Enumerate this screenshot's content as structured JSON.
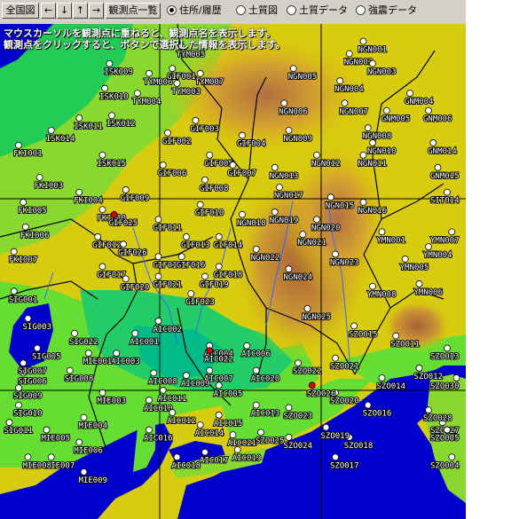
{
  "toolbar": {
    "overview_label": "全国図",
    "left_arrow": "←",
    "down_arrow": "↓",
    "up_arrow": "↑",
    "right_arrow": "→",
    "list_label": "観測点一覧",
    "radio_options": [
      {
        "label": "住所/履歴",
        "selected": true
      },
      {
        "label": "土質図",
        "selected": false
      },
      {
        "label": "土質データ",
        "selected": false
      },
      {
        "label": "強震データ",
        "selected": false
      }
    ]
  },
  "info": {
    "line1": "マウスカーソルを観測点に重ねると、観測点名を表示します。",
    "line2": "観測点をクリックすると、ボタンで選択した情報を表示します。"
  },
  "colors": {
    "sea": "#0000cc",
    "lowland": "#00cc66",
    "plain": "#66dd33",
    "hill": "#ddcc00",
    "mountain": "#cc8844",
    "station": "#ffffff",
    "selected_station": "#dd0000",
    "border": "#000000",
    "river": "#3366ff"
  },
  "stations": [
    {
      "id": "ISK009",
      "lon": 0.235,
      "lat": 0.08
    },
    {
      "id": "ISK010",
      "lon": 0.225,
      "lat": 0.13
    },
    {
      "id": "ISK011",
      "lon": 0.17,
      "lat": 0.19
    },
    {
      "id": "ISK012",
      "lon": 0.24,
      "lat": 0.185
    },
    {
      "id": "ISK014",
      "lon": 0.11,
      "lat": 0.215
    },
    {
      "id": "ISK015",
      "lon": 0.22,
      "lat": 0.265
    },
    {
      "id": "FKI001",
      "lon": 0.04,
      "lat": 0.245
    },
    {
      "id": "FKI003",
      "lon": 0.085,
      "lat": 0.31
    },
    {
      "id": "FKI004",
      "lon": 0.17,
      "lat": 0.34
    },
    {
      "id": "FKI005",
      "lon": 0.05,
      "lat": 0.36
    },
    {
      "id": "FKI006",
      "lon": 0.055,
      "lat": 0.41
    },
    {
      "id": "FKI007",
      "lon": 0.03,
      "lat": 0.46
    },
    {
      "id": "FKI010",
      "lon": 0.22,
      "lat": 0.375
    },
    {
      "id": "TYM005",
      "lon": 0.39,
      "lat": 0.045
    },
    {
      "id": "TYM006",
      "lon": 0.32,
      "lat": 0.1
    },
    {
      "id": "TYM007",
      "lon": 0.43,
      "lat": 0.1
    },
    {
      "id": "TYM003",
      "lon": 0.38,
      "lat": 0.12
    },
    {
      "id": "TYM004",
      "lon": 0.295,
      "lat": 0.14
    },
    {
      "id": "GIF001",
      "lon": 0.37,
      "lat": 0.09
    },
    {
      "id": "GIF002",
      "lon": 0.36,
      "lat": 0.22
    },
    {
      "id": "GIF003",
      "lon": 0.42,
      "lat": 0.195
    },
    {
      "id": "GIF004",
      "lon": 0.52,
      "lat": 0.225
    },
    {
      "id": "GIF005",
      "lon": 0.45,
      "lat": 0.265
    },
    {
      "id": "GIF006",
      "lon": 0.35,
      "lat": 0.285
    },
    {
      "id": "GIF007",
      "lon": 0.5,
      "lat": 0.285
    },
    {
      "id": "GIF008",
      "lon": 0.44,
      "lat": 0.315
    },
    {
      "id": "GIF009",
      "lon": 0.27,
      "lat": 0.335
    },
    {
      "id": "GIF010",
      "lon": 0.43,
      "lat": 0.365
    },
    {
      "id": "GIF011",
      "lon": 0.34,
      "lat": 0.395
    },
    {
      "id": "GIF012",
      "lon": 0.21,
      "lat": 0.43
    },
    {
      "id": "GIF013",
      "lon": 0.4,
      "lat": 0.43
    },
    {
      "id": "GIF014",
      "lon": 0.47,
      "lat": 0.43
    },
    {
      "id": "GIF015",
      "lon": 0.34,
      "lat": 0.47
    },
    {
      "id": "GIF016",
      "lon": 0.39,
      "lat": 0.47
    },
    {
      "id": "GIF017",
      "lon": 0.22,
      "lat": 0.49
    },
    {
      "id": "GIF018",
      "lon": 0.47,
      "lat": 0.49
    },
    {
      "id": "GIF019",
      "lon": 0.44,
      "lat": 0.51
    },
    {
      "id": "GIF020",
      "lon": 0.27,
      "lat": 0.515
    },
    {
      "id": "GIF021",
      "lon": 0.34,
      "lat": 0.51
    },
    {
      "id": "GIF023",
      "lon": 0.41,
      "lat": 0.545
    },
    {
      "id": "GIF025",
      "lon": 0.245,
      "lat": 0.385,
      "selected": true
    },
    {
      "id": "GIF026",
      "lon": 0.265,
      "lat": 0.445
    },
    {
      "id": "NGN001",
      "lon": 0.78,
      "lat": 0.035
    },
    {
      "id": "NGN002",
      "lon": 0.75,
      "lat": 0.06
    },
    {
      "id": "NGN003",
      "lon": 0.8,
      "lat": 0.08
    },
    {
      "id": "NGN004",
      "lon": 0.73,
      "lat": 0.115
    },
    {
      "id": "NGN005",
      "lon": 0.63,
      "lat": 0.09
    },
    {
      "id": "NGN006",
      "lon": 0.61,
      "lat": 0.16
    },
    {
      "id": "NGN007",
      "lon": 0.74,
      "lat": 0.16
    },
    {
      "id": "NGN008",
      "lon": 0.79,
      "lat": 0.21
    },
    {
      "id": "NGN009",
      "lon": 0.62,
      "lat": 0.215
    },
    {
      "id": "NGN010",
      "lon": 0.8,
      "lat": 0.24
    },
    {
      "id": "NGN011",
      "lon": 0.78,
      "lat": 0.265
    },
    {
      "id": "NGN012",
      "lon": 0.68,
      "lat": 0.265
    },
    {
      "id": "NGN013",
      "lon": 0.59,
      "lat": 0.29
    },
    {
      "id": "NGN015",
      "lon": 0.71,
      "lat": 0.35
    },
    {
      "id": "NGN016",
      "lon": 0.78,
      "lat": 0.36
    },
    {
      "id": "NGN017",
      "lon": 0.6,
      "lat": 0.33
    },
    {
      "id": "NGN018",
      "lon": 0.52,
      "lat": 0.385
    },
    {
      "id": "NGN019",
      "lon": 0.59,
      "lat": 0.38
    },
    {
      "id": "NGN020",
      "lon": 0.68,
      "lat": 0.395
    },
    {
      "id": "NGN021",
      "lon": 0.65,
      "lat": 0.425
    },
    {
      "id": "NGN022",
      "lon": 0.55,
      "lat": 0.455
    },
    {
      "id": "NGN023",
      "lon": 0.72,
      "lat": 0.465
    },
    {
      "id": "NGN024",
      "lon": 0.62,
      "lat": 0.495
    },
    {
      "id": "NGN025",
      "lon": 0.66,
      "lat": 0.575
    },
    {
      "id": "GNM004",
      "lon": 0.88,
      "lat": 0.14
    },
    {
      "id": "GNM005",
      "lon": 0.83,
      "lat": 0.175
    },
    {
      "id": "GNM006",
      "lon": 0.92,
      "lat": 0.175
    },
    {
      "id": "GNM014",
      "lon": 0.93,
      "lat": 0.24
    },
    {
      "id": "GNM015",
      "lon": 0.94,
      "lat": 0.29
    },
    {
      "id": "SIT014",
      "lon": 0.96,
      "lat": 0.34
    },
    {
      "id": "YMN001",
      "lon": 0.82,
      "lat": 0.42
    },
    {
      "id": "YMN004",
      "lon": 0.92,
      "lat": 0.45
    },
    {
      "id": "YMN005",
      "lon": 0.87,
      "lat": 0.475
    },
    {
      "id": "YMN006",
      "lon": 0.9,
      "lat": 0.525
    },
    {
      "id": "YMN007",
      "lon": 0.97,
      "lat": 0.42
    },
    {
      "id": "YMN008",
      "lon": 0.8,
      "lat": 0.53
    },
    {
      "id": "SZO011",
      "lon": 0.85,
      "lat": 0.63
    },
    {
      "id": "SZO012",
      "lon": 0.9,
      "lat": 0.695
    },
    {
      "id": "SZO013",
      "lon": 0.96,
      "lat": 0.655
    },
    {
      "id": "SZO014",
      "lon": 0.82,
      "lat": 0.715
    },
    {
      "id": "SZO015",
      "lon": 0.76,
      "lat": 0.61
    },
    {
      "id": "SZO016",
      "lon": 0.79,
      "lat": 0.77
    },
    {
      "id": "SZO017",
      "lon": 0.72,
      "lat": 0.875
    },
    {
      "id": "SZO018",
      "lon": 0.75,
      "lat": 0.835
    },
    {
      "id": "SZO019",
      "lon": 0.7,
      "lat": 0.815
    },
    {
      "id": "SZO020",
      "lon": 0.72,
      "lat": 0.745
    },
    {
      "id": "SZO021",
      "lon": 0.72,
      "lat": 0.675
    },
    {
      "id": "SZO022",
      "lon": 0.64,
      "lat": 0.685
    },
    {
      "id": "SZO023",
      "lon": 0.62,
      "lat": 0.775
    },
    {
      "id": "SZO024",
      "lon": 0.62,
      "lat": 0.835
    },
    {
      "id": "SZO025",
      "lon": 0.56,
      "lat": 0.825
    },
    {
      "id": "SZO026",
      "lon": 0.67,
      "lat": 0.73,
      "selected": true
    },
    {
      "id": "SZO027",
      "lon": 0.95,
      "lat": 0.805
    },
    {
      "id": "SZO028",
      "lon": 0.92,
      "lat": 0.78
    },
    {
      "id": "SZO004",
      "lon": 0.97,
      "lat": 0.875
    },
    {
      "id": "SZO005",
      "lon": 0.96,
      "lat": 0.82
    },
    {
      "id": "SZO030",
      "lon": 0.98,
      "lat": 0.715
    },
    {
      "id": "AIC001",
      "lon": 0.29,
      "lat": 0.625
    },
    {
      "id": "AIC002",
      "lon": 0.34,
      "lat": 0.6
    },
    {
      "id": "AIC003",
      "lon": 0.25,
      "lat": 0.665
    },
    {
      "id": "AIC004",
      "lon": 0.45,
      "lat": 0.65
    },
    {
      "id": "AIC005",
      "lon": 0.47,
      "lat": 0.73
    },
    {
      "id": "AIC006",
      "lon": 0.53,
      "lat": 0.65
    },
    {
      "id": "AIC007",
      "lon": 0.45,
      "lat": 0.7
    },
    {
      "id": "AIC008",
      "lon": 0.33,
      "lat": 0.705
    },
    {
      "id": "AIC009",
      "lon": 0.4,
      "lat": 0.71
    },
    {
      "id": "AIC010",
      "lon": 0.32,
      "lat": 0.76
    },
    {
      "id": "AIC011",
      "lon": 0.35,
      "lat": 0.74
    },
    {
      "id": "AIC012",
      "lon": 0.37,
      "lat": 0.785
    },
    {
      "id": "AIC013",
      "lon": 0.55,
      "lat": 0.77
    },
    {
      "id": "AIC014",
      "lon": 0.43,
      "lat": 0.81
    },
    {
      "id": "AIC015",
      "lon": 0.47,
      "lat": 0.79
    },
    {
      "id": "AIC016",
      "lon": 0.32,
      "lat": 0.82
    },
    {
      "id": "AIC017",
      "lon": 0.44,
      "lat": 0.865
    },
    {
      "id": "AIC018",
      "lon": 0.38,
      "lat": 0.875
    },
    {
      "id": "AIC019",
      "lon": 0.51,
      "lat": 0.86
    },
    {
      "id": "AIC020",
      "lon": 0.55,
      "lat": 0.7
    },
    {
      "id": "AIC021",
      "lon": 0.5,
      "lat": 0.83
    },
    {
      "id": "AIC022",
      "lon": 0.45,
      "lat": 0.66,
      "selected": true
    },
    {
      "id": "MIE001",
      "lon": 0.19,
      "lat": 0.665
    },
    {
      "id": "MIE003",
      "lon": 0.22,
      "lat": 0.745
    },
    {
      "id": "MIE004",
      "lon": 0.18,
      "lat": 0.795
    },
    {
      "id": "MIE005",
      "lon": 0.1,
      "lat": 0.82
    },
    {
      "id": "MIE006",
      "lon": 0.17,
      "lat": 0.845
    },
    {
      "id": "MIE007",
      "lon": 0.11,
      "lat": 0.875
    },
    {
      "id": "MIE008",
      "lon": 0.06,
      "lat": 0.875
    },
    {
      "id": "MIE009",
      "lon": 0.18,
      "lat": 0.905
    },
    {
      "id": "SIG001",
      "lon": 0.03,
      "lat": 0.54
    },
    {
      "id": "SIG003",
      "lon": 0.06,
      "lat": 0.595
    },
    {
      "id": "SIG005",
      "lon": 0.08,
      "lat": 0.655
    },
    {
      "id": "SIG006",
      "lon": 0.05,
      "lat": 0.705
    },
    {
      "id": "SIG007",
      "lon": 0.05,
      "lat": 0.685
    },
    {
      "id": "SIG008",
      "lon": 0.15,
      "lat": 0.7
    },
    {
      "id": "SIG009",
      "lon": 0.04,
      "lat": 0.735
    },
    {
      "id": "SIG010",
      "lon": 0.04,
      "lat": 0.77
    },
    {
      "id": "SIG011",
      "lon": 0.02,
      "lat": 0.805
    },
    {
      "id": "SIG022",
      "lon": 0.16,
      "lat": 0.625
    }
  ]
}
